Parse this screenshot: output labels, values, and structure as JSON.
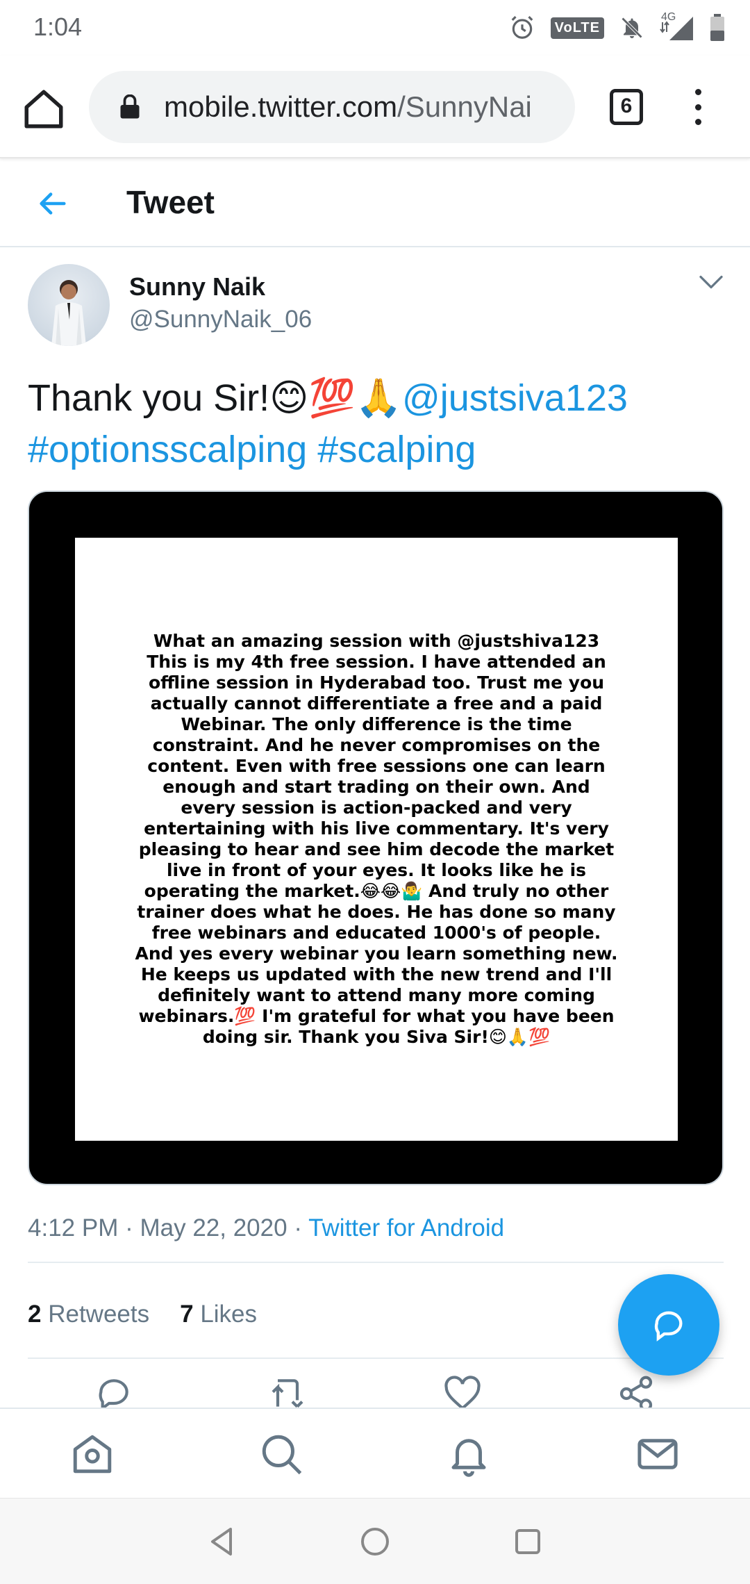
{
  "status_bar": {
    "time": "1:04",
    "volte_label": "VoLTE",
    "network_label": "4G",
    "icons": [
      "alarm-icon",
      "volte-icon",
      "notifications-off-icon",
      "signal-icon",
      "battery-icon"
    ]
  },
  "browser": {
    "url_host": "mobile.twitter.com",
    "url_path": "/SunnyNai",
    "tab_count": "6"
  },
  "header": {
    "title": "Tweet"
  },
  "tweet": {
    "author_name": "Sunny Naik",
    "author_handle": "@SunnyNaik_06",
    "text_plain": "Thank you Sir!",
    "text_emojis": "😊💯🙏",
    "mention": "@justsiva123",
    "hashtags": "#optionsscalping #scalping",
    "image_text": "What an amazing session with @justshiva123 This is my 4th free session. I have attended an offline session in Hyderabad too. Trust me you actually cannot differentiate a free and a paid Webinar. The only difference is the time constraint. And he never compromises on the content. Even with free sessions one can learn enough and start trading on their own. And every session is action-packed and very entertaining with his live commentary. It's very pleasing to hear and see him decode the market live in front of your eyes. It looks like he is operating the market.😂😂🤷‍♂️ And truly no other trainer does what he does. He has done so many free webinars and educated 1000's of people. And yes every webinar you learn something new. He keeps us updated with the new trend and I'll definitely want to attend many more coming webinars.💯 I'm grateful for what you have been doing sir. Thank you Siva Sir!😊🙏💯",
    "time": "4:12 PM",
    "separator": "·",
    "date": "May 22, 2020",
    "source": "Twitter for Android",
    "retweets_count": "2",
    "retweets_label": "Retweets",
    "likes_count": "7",
    "likes_label": "Likes"
  },
  "colors": {
    "accent": "#1da1f2",
    "link": "#1b95e0",
    "secondary_text": "#657786"
  }
}
